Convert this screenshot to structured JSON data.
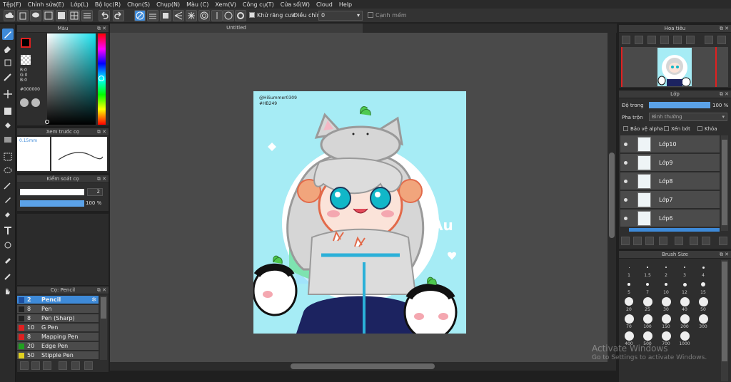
{
  "menu": [
    "Tệp(F)",
    "Chỉnh sửa(E)",
    "Lớp(L)",
    "Bộ lọc(R)",
    "Chọn(S)",
    "Chụp(N)",
    "Màu (C)",
    "Xem(V)",
    "Công cụ(T)",
    "Cửa sổ(W)",
    "Cloud",
    "Help"
  ],
  "toolbar": {
    "antialias_label": "Khử răng cưa",
    "adjust_label": "Điều chỉnh",
    "adjust_value": "0",
    "soft_edge_label": "Cạnh mềm"
  },
  "color_panel": {
    "title": "Màu",
    "r": "R:0",
    "g": "G:0",
    "b": "B:0",
    "hex": "#000000"
  },
  "brush_preview": {
    "title": "Xem trước cọ",
    "size": "0.15mm"
  },
  "brush_control": {
    "title": "Kiểm soát cọ",
    "size_value": "2",
    "opacity_value": "100 %"
  },
  "brush_list": {
    "title": "Cọ: Pencil",
    "items": [
      {
        "size": "2",
        "name": "Pencil",
        "color": "#1d4fa0"
      },
      {
        "size": "8",
        "name": "Pen",
        "color": "#222222"
      },
      {
        "size": "8",
        "name": "Pen (Sharp)",
        "color": "#222222"
      },
      {
        "size": "10",
        "name": "G Pen",
        "color": "#e02020"
      },
      {
        "size": "8",
        "name": "Mapping Pen",
        "color": "#e02020"
      },
      {
        "size": "20",
        "name": "Edge Pen",
        "color": "#20a020"
      },
      {
        "size": "50",
        "name": "Stipple Pen",
        "color": "#e0d020"
      }
    ]
  },
  "document": {
    "tab_title": "Untitled",
    "signature_1": "@HiSummer0309",
    "signature_2": "#HB249",
    "art_text": "Au"
  },
  "navigator": {
    "title": "Hoa tiêu"
  },
  "layers": {
    "title": "Lớp",
    "opacity_label": "Độ trong",
    "opacity_value": "100 %",
    "blend_label": "Pha trộn",
    "blend_value": "Bình thường",
    "protect_alpha": "Bảo vệ alpha",
    "clipping": "Xén bớt",
    "lock": "Khóa",
    "items": [
      "Lớp10",
      "Lớp9",
      "Lớp8",
      "Lớp7",
      "Lớp6"
    ]
  },
  "brush_size": {
    "title": "Brush Size",
    "values": [
      "1",
      "1.5",
      "2",
      "3",
      "4",
      "5",
      "7",
      "10",
      "12",
      "15",
      "20",
      "25",
      "30",
      "40",
      "50",
      "70",
      "100",
      "150",
      "200",
      "300",
      "400",
      "500",
      "700",
      "1000"
    ]
  },
  "watermark": {
    "line1": "Activate Windows",
    "line2": "Go to Settings to activate Windows."
  },
  "colors": {
    "accent": "#3e8ad8",
    "background": "#1f1f1f",
    "canvas_bg": "#a6ecf5"
  }
}
